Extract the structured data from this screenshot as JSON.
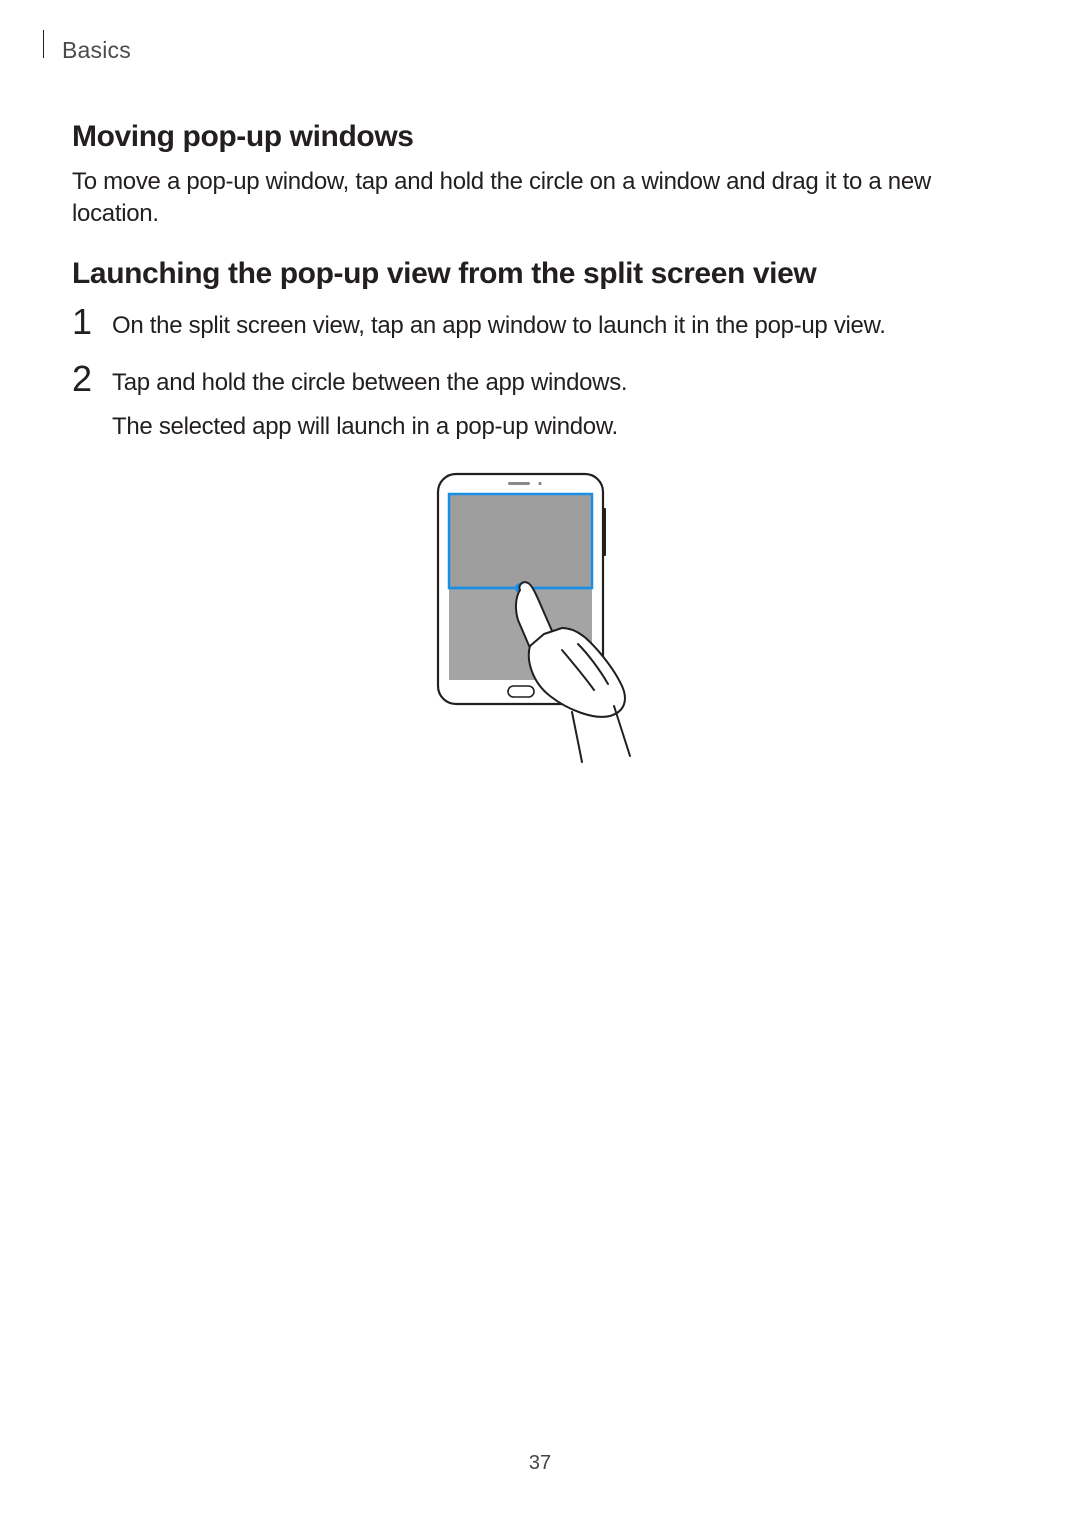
{
  "breadcrumb": "Basics",
  "section1": {
    "title": "Moving pop-up windows",
    "body": "To move a pop-up window, tap and hold the circle on a window and drag it to a new location."
  },
  "section2": {
    "title": "Launching the pop-up view from the split screen view",
    "steps": [
      {
        "p1": "On the split screen view, tap an app window to launch it in the pop-up view."
      },
      {
        "p1": "Tap and hold the circle between the app windows.",
        "p2": "The selected app will launch in a pop-up window."
      }
    ]
  },
  "page_number": "37"
}
